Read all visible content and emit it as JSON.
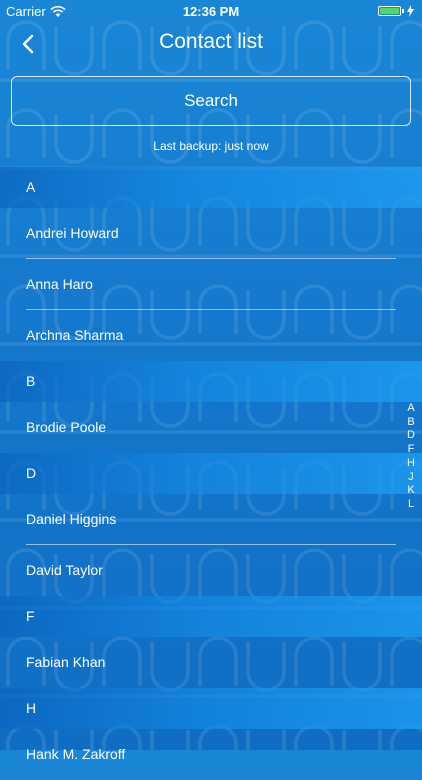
{
  "status_bar": {
    "carrier": "Carrier",
    "time": "12:36 PM",
    "battery_color": "#4cd964"
  },
  "nav": {
    "title": "Contact list",
    "back_icon": "chevron-left-icon"
  },
  "search": {
    "placeholder": "Search",
    "value": ""
  },
  "backup_text": "Last backup: just now",
  "sections": [
    {
      "letter": "A",
      "contacts": [
        "Andrei Howard",
        "Anna  Haro",
        "Archna  Sharma"
      ]
    },
    {
      "letter": "B",
      "contacts": [
        "Brodie Poole"
      ]
    },
    {
      "letter": "D",
      "contacts": [
        "Daniel  Higgins",
        "David  Taylor"
      ]
    },
    {
      "letter": "F",
      "contacts": [
        "Fabian Khan"
      ]
    },
    {
      "letter": "H",
      "contacts": [
        "Hank M. Zakroff"
      ]
    }
  ],
  "index_letters": [
    "A",
    "B",
    "D",
    "F",
    "H",
    "J",
    "K",
    "L"
  ],
  "colors": {
    "background": "#1478cd",
    "text": "#ffffff"
  }
}
